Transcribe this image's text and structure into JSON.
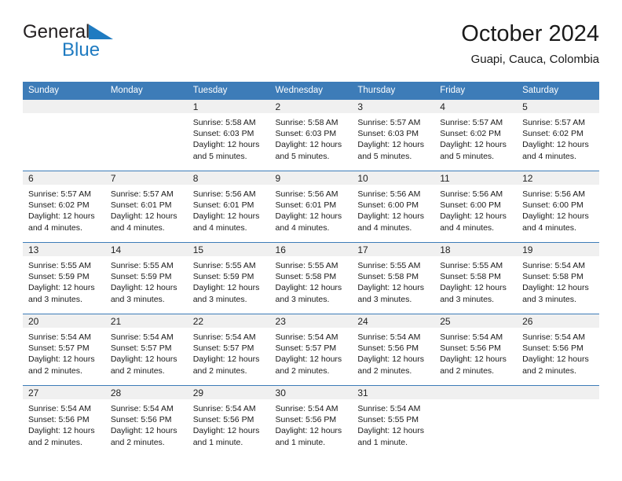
{
  "brand": {
    "name_top": "General",
    "name_bottom": "Blue",
    "triangle_color": "#1f7bc1",
    "text_color": "#231f20"
  },
  "header": {
    "title": "October 2024",
    "subtitle": "Guapi, Cauca, Colombia"
  },
  "colors": {
    "header_blue": "#3d7cb8",
    "daynum_band": "#f0f0f0",
    "text": "#1a1a1a"
  },
  "weekday_headers": [
    "Sunday",
    "Monday",
    "Tuesday",
    "Wednesday",
    "Thursday",
    "Friday",
    "Saturday"
  ],
  "weeks": [
    [
      {
        "day": "",
        "lines": []
      },
      {
        "day": "",
        "lines": []
      },
      {
        "day": "1",
        "lines": [
          "Sunrise: 5:58 AM",
          "Sunset: 6:03 PM",
          "Daylight: 12 hours",
          "and 5 minutes."
        ]
      },
      {
        "day": "2",
        "lines": [
          "Sunrise: 5:58 AM",
          "Sunset: 6:03 PM",
          "Daylight: 12 hours",
          "and 5 minutes."
        ]
      },
      {
        "day": "3",
        "lines": [
          "Sunrise: 5:57 AM",
          "Sunset: 6:03 PM",
          "Daylight: 12 hours",
          "and 5 minutes."
        ]
      },
      {
        "day": "4",
        "lines": [
          "Sunrise: 5:57 AM",
          "Sunset: 6:02 PM",
          "Daylight: 12 hours",
          "and 5 minutes."
        ]
      },
      {
        "day": "5",
        "lines": [
          "Sunrise: 5:57 AM",
          "Sunset: 6:02 PM",
          "Daylight: 12 hours",
          "and 4 minutes."
        ]
      }
    ],
    [
      {
        "day": "6",
        "lines": [
          "Sunrise: 5:57 AM",
          "Sunset: 6:02 PM",
          "Daylight: 12 hours",
          "and 4 minutes."
        ]
      },
      {
        "day": "7",
        "lines": [
          "Sunrise: 5:57 AM",
          "Sunset: 6:01 PM",
          "Daylight: 12 hours",
          "and 4 minutes."
        ]
      },
      {
        "day": "8",
        "lines": [
          "Sunrise: 5:56 AM",
          "Sunset: 6:01 PM",
          "Daylight: 12 hours",
          "and 4 minutes."
        ]
      },
      {
        "day": "9",
        "lines": [
          "Sunrise: 5:56 AM",
          "Sunset: 6:01 PM",
          "Daylight: 12 hours",
          "and 4 minutes."
        ]
      },
      {
        "day": "10",
        "lines": [
          "Sunrise: 5:56 AM",
          "Sunset: 6:00 PM",
          "Daylight: 12 hours",
          "and 4 minutes."
        ]
      },
      {
        "day": "11",
        "lines": [
          "Sunrise: 5:56 AM",
          "Sunset: 6:00 PM",
          "Daylight: 12 hours",
          "and 4 minutes."
        ]
      },
      {
        "day": "12",
        "lines": [
          "Sunrise: 5:56 AM",
          "Sunset: 6:00 PM",
          "Daylight: 12 hours",
          "and 4 minutes."
        ]
      }
    ],
    [
      {
        "day": "13",
        "lines": [
          "Sunrise: 5:55 AM",
          "Sunset: 5:59 PM",
          "Daylight: 12 hours",
          "and 3 minutes."
        ]
      },
      {
        "day": "14",
        "lines": [
          "Sunrise: 5:55 AM",
          "Sunset: 5:59 PM",
          "Daylight: 12 hours",
          "and 3 minutes."
        ]
      },
      {
        "day": "15",
        "lines": [
          "Sunrise: 5:55 AM",
          "Sunset: 5:59 PM",
          "Daylight: 12 hours",
          "and 3 minutes."
        ]
      },
      {
        "day": "16",
        "lines": [
          "Sunrise: 5:55 AM",
          "Sunset: 5:58 PM",
          "Daylight: 12 hours",
          "and 3 minutes."
        ]
      },
      {
        "day": "17",
        "lines": [
          "Sunrise: 5:55 AM",
          "Sunset: 5:58 PM",
          "Daylight: 12 hours",
          "and 3 minutes."
        ]
      },
      {
        "day": "18",
        "lines": [
          "Sunrise: 5:55 AM",
          "Sunset: 5:58 PM",
          "Daylight: 12 hours",
          "and 3 minutes."
        ]
      },
      {
        "day": "19",
        "lines": [
          "Sunrise: 5:54 AM",
          "Sunset: 5:58 PM",
          "Daylight: 12 hours",
          "and 3 minutes."
        ]
      }
    ],
    [
      {
        "day": "20",
        "lines": [
          "Sunrise: 5:54 AM",
          "Sunset: 5:57 PM",
          "Daylight: 12 hours",
          "and 2 minutes."
        ]
      },
      {
        "day": "21",
        "lines": [
          "Sunrise: 5:54 AM",
          "Sunset: 5:57 PM",
          "Daylight: 12 hours",
          "and 2 minutes."
        ]
      },
      {
        "day": "22",
        "lines": [
          "Sunrise: 5:54 AM",
          "Sunset: 5:57 PM",
          "Daylight: 12 hours",
          "and 2 minutes."
        ]
      },
      {
        "day": "23",
        "lines": [
          "Sunrise: 5:54 AM",
          "Sunset: 5:57 PM",
          "Daylight: 12 hours",
          "and 2 minutes."
        ]
      },
      {
        "day": "24",
        "lines": [
          "Sunrise: 5:54 AM",
          "Sunset: 5:56 PM",
          "Daylight: 12 hours",
          "and 2 minutes."
        ]
      },
      {
        "day": "25",
        "lines": [
          "Sunrise: 5:54 AM",
          "Sunset: 5:56 PM",
          "Daylight: 12 hours",
          "and 2 minutes."
        ]
      },
      {
        "day": "26",
        "lines": [
          "Sunrise: 5:54 AM",
          "Sunset: 5:56 PM",
          "Daylight: 12 hours",
          "and 2 minutes."
        ]
      }
    ],
    [
      {
        "day": "27",
        "lines": [
          "Sunrise: 5:54 AM",
          "Sunset: 5:56 PM",
          "Daylight: 12 hours",
          "and 2 minutes."
        ]
      },
      {
        "day": "28",
        "lines": [
          "Sunrise: 5:54 AM",
          "Sunset: 5:56 PM",
          "Daylight: 12 hours",
          "and 2 minutes."
        ]
      },
      {
        "day": "29",
        "lines": [
          "Sunrise: 5:54 AM",
          "Sunset: 5:56 PM",
          "Daylight: 12 hours",
          "and 1 minute."
        ]
      },
      {
        "day": "30",
        "lines": [
          "Sunrise: 5:54 AM",
          "Sunset: 5:56 PM",
          "Daylight: 12 hours",
          "and 1 minute."
        ]
      },
      {
        "day": "31",
        "lines": [
          "Sunrise: 5:54 AM",
          "Sunset: 5:55 PM",
          "Daylight: 12 hours",
          "and 1 minute."
        ]
      },
      {
        "day": "",
        "lines": []
      },
      {
        "day": "",
        "lines": []
      }
    ]
  ]
}
